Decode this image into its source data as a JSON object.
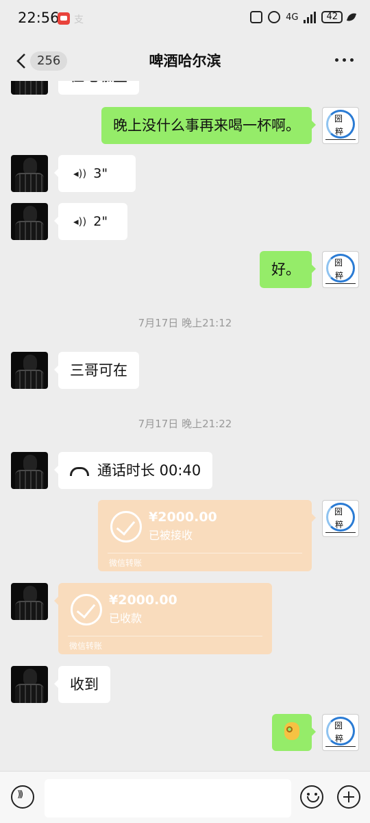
{
  "status_bar": {
    "time": "22:56",
    "network": "4G",
    "battery": "42"
  },
  "header": {
    "unread_count": "256",
    "title": "啤酒哈尔滨"
  },
  "messages": {
    "partial_top": "住宅咖里",
    "m1": "晚上没什么事再来喝一杯啊。",
    "v1": "3\"",
    "v2": "2\"",
    "m2": "好。",
    "t1": "7月17日 晚上21:12",
    "m3": "三哥可在",
    "t2": "7月17日 晚上21:22",
    "call": "通话时长 00:40",
    "tr1": {
      "amount": "¥2000.00",
      "status": "已被接收",
      "label": "微信转账"
    },
    "tr2": {
      "amount": "¥2000.00",
      "status": "已收款",
      "label": "微信转账"
    },
    "m4": "收到"
  },
  "avatar_right": {
    "line1": "圀",
    "line2": "粹"
  },
  "colors": {
    "outgoing_bubble": "#95ec69",
    "incoming_bubble": "#ffffff",
    "transfer_bubble": "#f9dcbd",
    "background": "#ededed"
  },
  "icons": [
    "back-arrow-icon",
    "more-icon",
    "voice-wave-icon",
    "phone-icon",
    "check-circle-icon",
    "ok-hand-emoji",
    "voice-input-icon",
    "emoji-icon",
    "plus-icon"
  ]
}
